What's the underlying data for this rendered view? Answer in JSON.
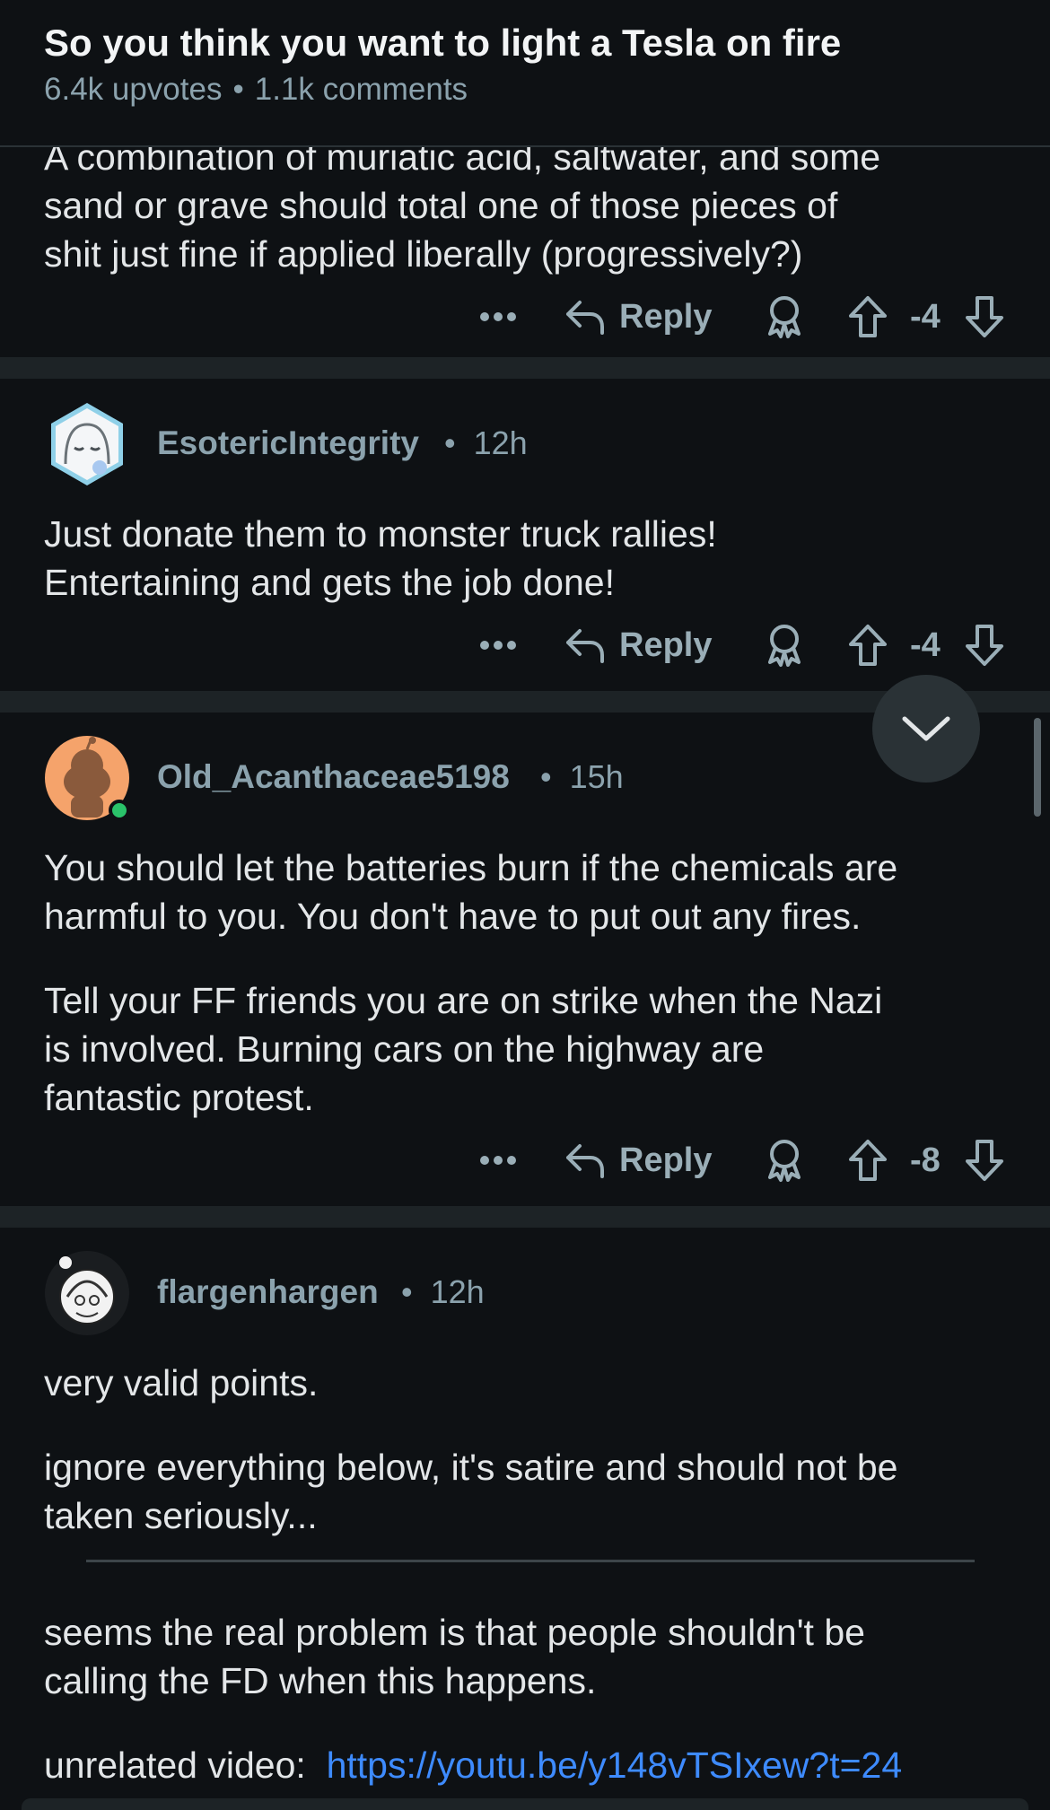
{
  "header": {
    "title": "So you think you want to light a Tesla on fire",
    "upvotes": "6.4k upvotes",
    "separator": "•",
    "comments": "1.1k comments"
  },
  "comments": [
    {
      "body": [
        "A combination of muriatic acid, saltwater, and some",
        "sand or grave should total one of those pieces of",
        "shit just fine if applied liberally (progressively?)"
      ],
      "reply_label": "Reply",
      "score": "-4"
    },
    {
      "username": "EsotericIntegrity",
      "separator": "•",
      "time": "12h",
      "body": [
        "Just donate them to monster truck rallies!",
        "Entertaining and gets the job done!"
      ],
      "reply_label": "Reply",
      "score": "-4"
    },
    {
      "username": "Old_Acanthaceae5198",
      "separator": "•",
      "time": "15h",
      "body": [
        "You should let the batteries burn if the chemicals are",
        "harmful to you. You don't have to put out any fires.",
        "Tell your FF friends you are on strike when the Nazi",
        "is involved. Burning cars on the highway are",
        "fantastic protest."
      ],
      "reply_label": "Reply",
      "score": "-8"
    },
    {
      "username": "flargenhargen",
      "separator": "•",
      "time": "12h",
      "body": [
        "very valid points.",
        "ignore everything below, it's satire and should not be",
        "taken seriously...",
        "seems the real problem is that people shouldn't be",
        "calling the FD when this happens.",
        "unrelated video:"
      ],
      "link": "https://youtu.be/y148vTSIxew?t=24"
    }
  ],
  "icons": {
    "more": "more-options-icon",
    "reply": "reply-arrow-icon",
    "award": "award-icon",
    "upvote": "upvote-arrow-icon",
    "downvote": "downvote-arrow-icon",
    "collapse": "chevron-down-icon"
  },
  "colors": {
    "background": "#0e1114",
    "separator": "#1d2326",
    "meta": "#8ba2ad",
    "text": "#e3e6e8",
    "link": "#3e8bff",
    "online": "#2ac36a"
  }
}
